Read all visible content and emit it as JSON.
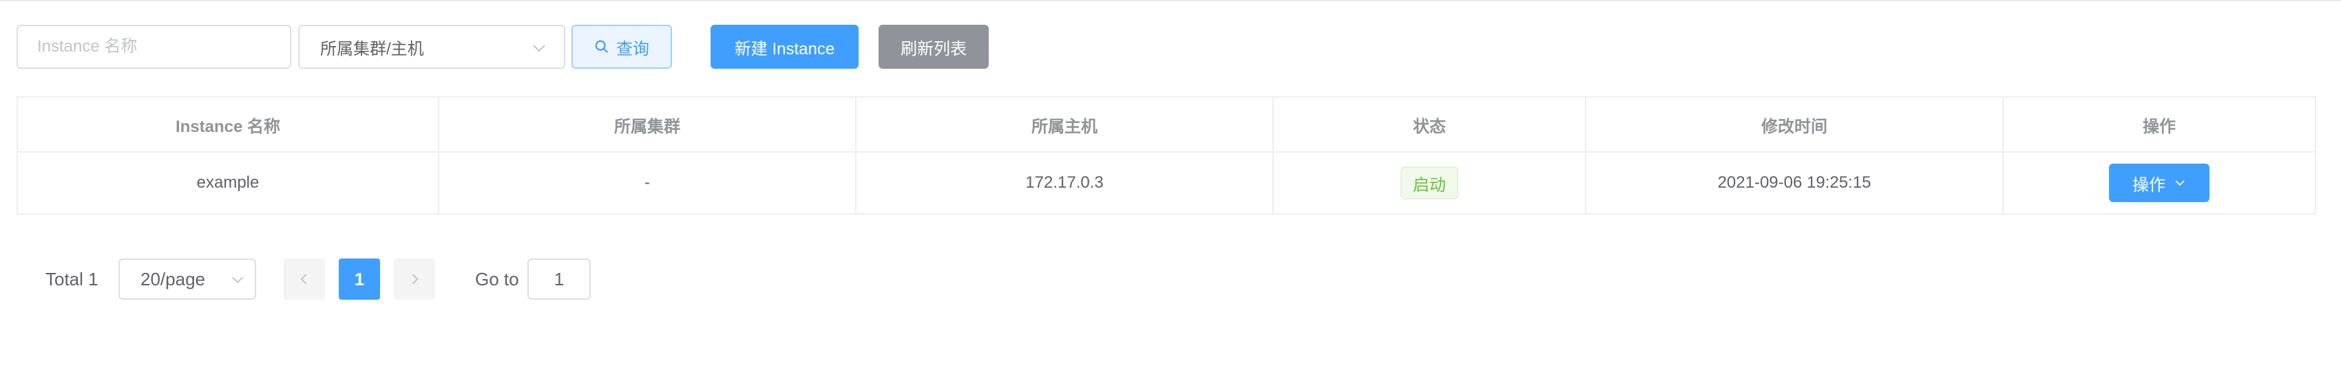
{
  "toolbar": {
    "search_placeholder": "Instance 名称",
    "cluster_select_value": "所属集群/主机",
    "query_label": "查询",
    "new_label": "新建 Instance",
    "refresh_label": "刷新列表"
  },
  "table": {
    "headers": [
      "Instance 名称",
      "所属集群",
      "所属主机",
      "状态",
      "修改时间",
      "操作"
    ],
    "rows": [
      {
        "name": "example",
        "cluster": "-",
        "host": "172.17.0.3",
        "status": "启动",
        "modified": "2021-09-06 19:25:15",
        "action": "操作"
      }
    ]
  },
  "pagination": {
    "total_label": "Total 1",
    "page_size": "20/page",
    "current_page": "1",
    "goto_label": "Go to",
    "goto_value": "1"
  },
  "colors": {
    "primary": "#409eff",
    "info": "#909399",
    "success": "#67c23a",
    "border": "#dcdfe6"
  },
  "icons": {
    "query": "search-icon",
    "select": "chevron-down-icon",
    "prev": "chevron-left-icon",
    "next": "chevron-right-icon"
  }
}
